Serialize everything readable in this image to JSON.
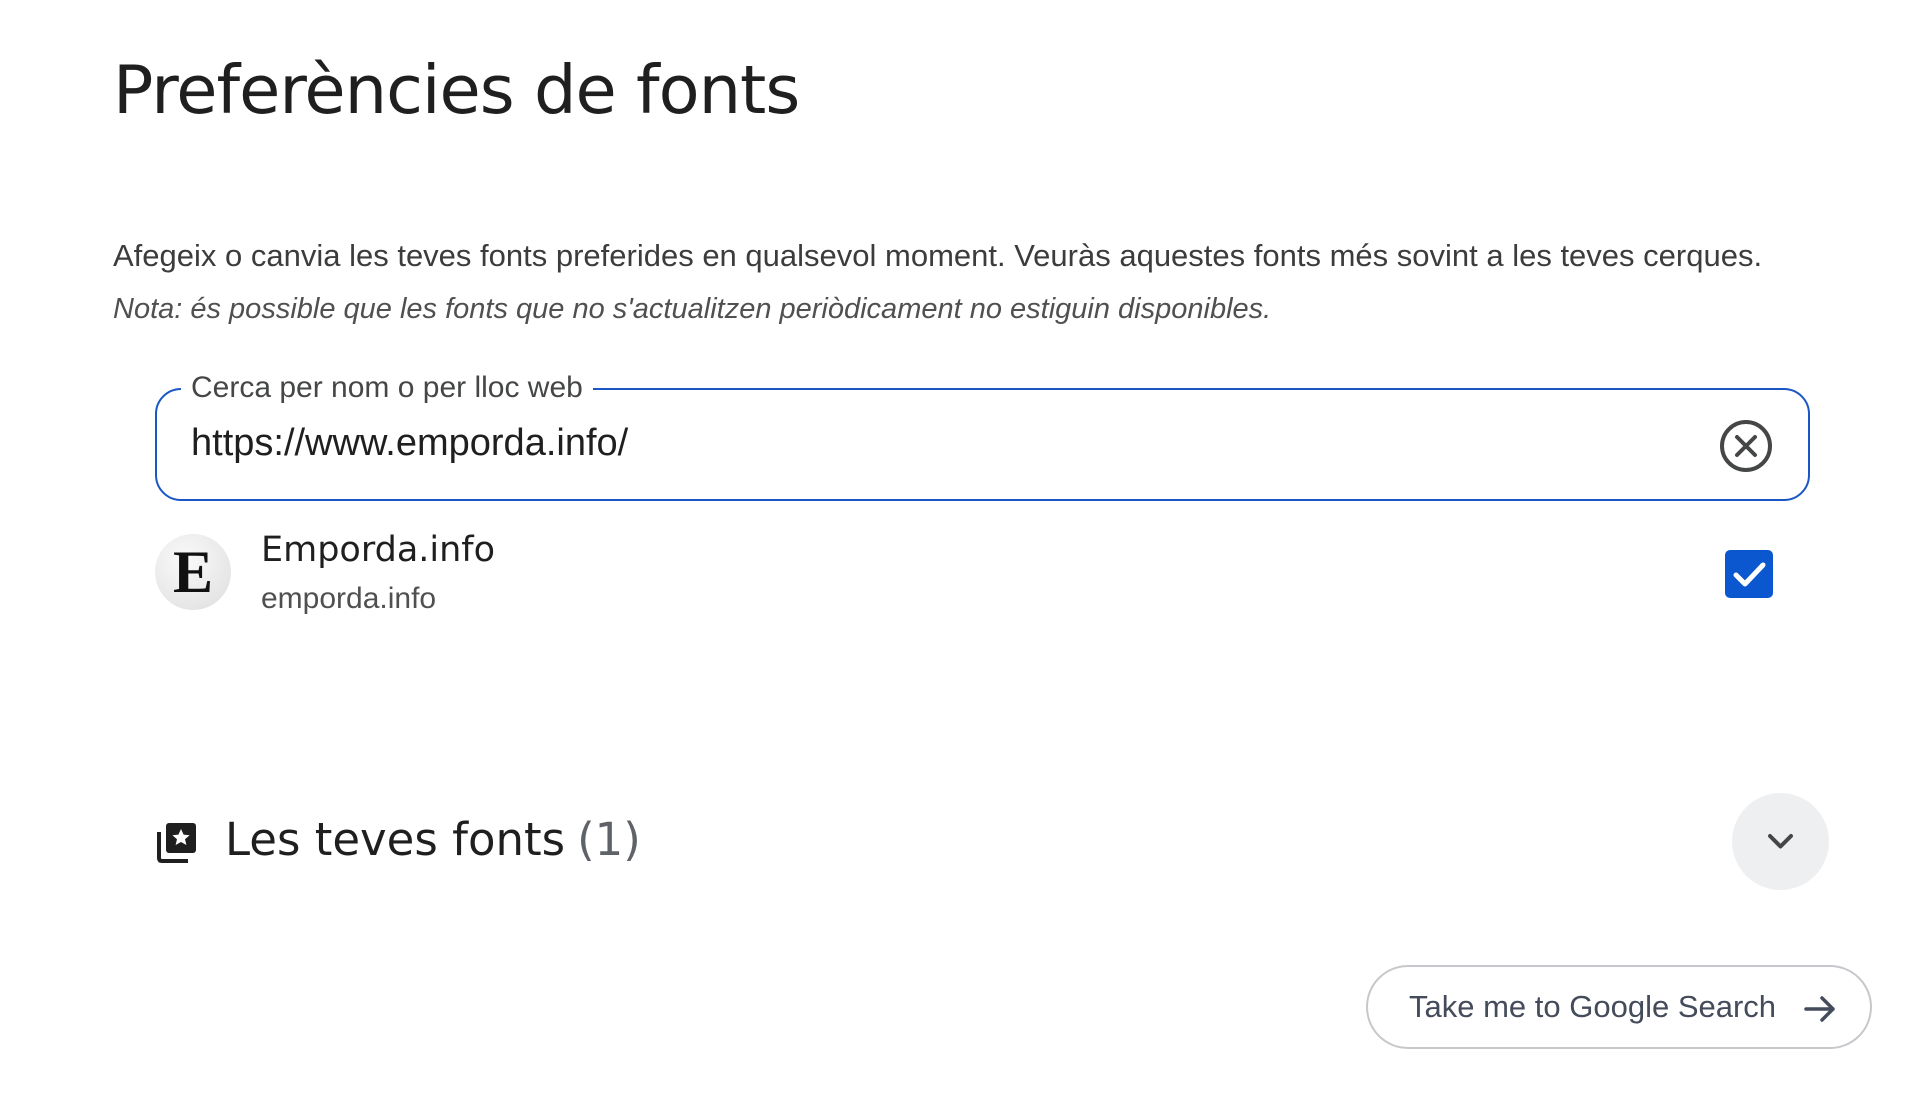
{
  "page": {
    "title": "Preferències de fonts",
    "description": "Afegeix o canvia les teves fonts preferides en qualsevol moment. Veuràs aquestes fonts més sovint a les teves cerques.",
    "note": "Nota: és possible que les fonts que no s'actualitzen periòdicament no estiguin disponibles."
  },
  "search": {
    "label": "Cerca per nom o per lloc web",
    "value": "https://www.emporda.info/",
    "clear_icon": "clear-circle-icon"
  },
  "results": [
    {
      "logo_letter": "E",
      "name": "Emporda.info",
      "domain": "emporda.info",
      "checked": true
    }
  ],
  "your_fonts": {
    "icon": "library-star-icon",
    "title": "Les teves fonts",
    "count": "(1)",
    "expand_icon": "chevron-down-icon"
  },
  "cta": {
    "label": "Take me to Google Search",
    "icon": "arrow-right-icon"
  },
  "colors": {
    "accent": "#0b57d0",
    "field_border": "#1a56c4",
    "text": "#1f1f1f",
    "secondary_text": "#505050"
  }
}
